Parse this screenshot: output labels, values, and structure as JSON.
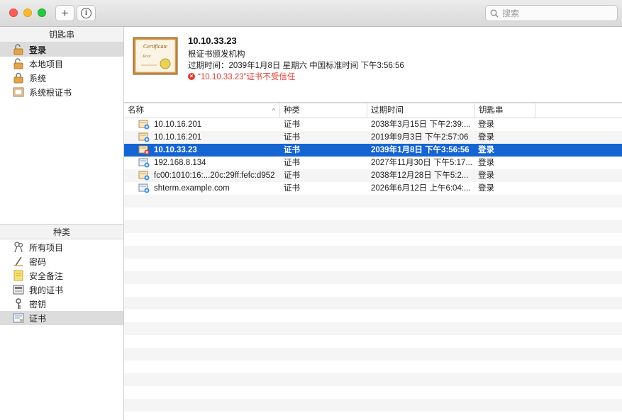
{
  "toolbar": {
    "add_label": "+",
    "info_label": "i",
    "search_placeholder": "搜索"
  },
  "sidebar": {
    "keychains_header": "钥匙串",
    "keychains": [
      {
        "label": "登录",
        "icon": "lock-open-icon"
      },
      {
        "label": "本地项目",
        "icon": "lock-open-icon"
      },
      {
        "label": "系统",
        "icon": "lock-closed-icon"
      },
      {
        "label": "系统根证书",
        "icon": "cabinet-icon"
      }
    ],
    "categories_header": "种类",
    "categories": [
      {
        "label": "所有项目",
        "icon": "all-items-icon"
      },
      {
        "label": "密码",
        "icon": "password-icon"
      },
      {
        "label": "安全备注",
        "icon": "secure-note-icon"
      },
      {
        "label": "我的证书",
        "icon": "my-certificate-icon"
      },
      {
        "label": "密钥",
        "icon": "key-icon"
      },
      {
        "label": "证书",
        "icon": "certificate-icon"
      }
    ]
  },
  "detail": {
    "title": "10.10.33.23",
    "issuer": "根证书颁发机构",
    "expiry": "过期时间：2039年1月8日 星期六 中国标准时间 下午3:56:56",
    "warning": "“10.10.33.23”证书不受信任",
    "cert_text_1": "Certificate",
    "cert_text_2": "Root"
  },
  "table": {
    "columns": [
      "名称",
      "种类",
      "过期时间",
      "钥匙串"
    ],
    "rows": [
      {
        "name": "10.10.16.201",
        "kind": "证书",
        "expires": "2038年3月15日 下午2:39:...",
        "keychain": "登录",
        "icon": "cert-plus-icon"
      },
      {
        "name": "10.10.16.201",
        "kind": "证书",
        "expires": "2019年9月3日 下午2:57:06",
        "keychain": "登录",
        "icon": "cert-plus-icon"
      },
      {
        "name": "10.10.33.23",
        "kind": "证书",
        "expires": "2039年1月8日 下午3:56:56",
        "keychain": "登录",
        "icon": "cert-untrusted-icon"
      },
      {
        "name": "192.168.8.134",
        "kind": "证书",
        "expires": "2027年11月30日 下午5:17...",
        "keychain": "登录",
        "icon": "cert-plus-icon"
      },
      {
        "name": "fc00:1010:16:...20c:29ff:fefc:d952",
        "kind": "证书",
        "expires": "2038年12月28日 下午5:2...",
        "keychain": "登录",
        "icon": "cert-plus-icon"
      },
      {
        "name": "shterm.example.com",
        "kind": "证书",
        "expires": "2026年6月12日 上午6:04:...",
        "keychain": "登录",
        "icon": "cert-plus-icon"
      }
    ]
  },
  "colors": {
    "selection": "#1464d2",
    "warning": "#e03c31"
  }
}
